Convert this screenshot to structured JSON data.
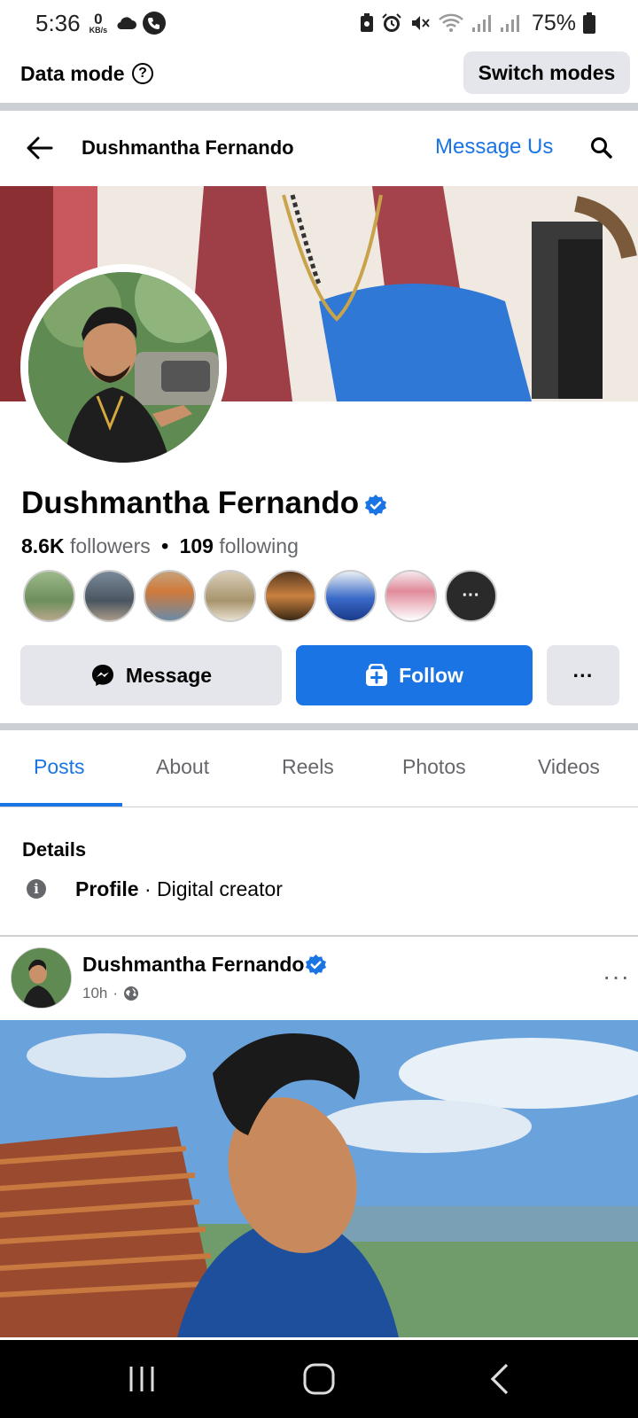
{
  "status_bar": {
    "time": "5:36",
    "net_speed_value": "0",
    "net_speed_unit": "KB/s",
    "battery_percent": "75%",
    "icons": [
      "cloud-icon",
      "phone-icon",
      "battery-saver-icon",
      "alarm-icon",
      "mute-icon",
      "wifi-icon",
      "signal-icon",
      "signal-icon",
      "battery-icon"
    ]
  },
  "data_mode": {
    "label": "Data mode",
    "help_icon": "?",
    "switch_label": "Switch modes"
  },
  "header": {
    "title": "Dushmantha Fernando",
    "message_us": "Message Us"
  },
  "profile": {
    "name": "Dushmantha Fernando",
    "followers_count": "8.6K",
    "followers_label": "followers",
    "following_count": "109",
    "following_label": "following",
    "verified": true,
    "friends_preview_count": 8
  },
  "actions": {
    "message": "Message",
    "follow": "Follow",
    "more": "···"
  },
  "tabs": [
    {
      "label": "Posts",
      "active": true
    },
    {
      "label": "About",
      "active": false
    },
    {
      "label": "Reels",
      "active": false
    },
    {
      "label": "Photos",
      "active": false
    },
    {
      "label": "Videos",
      "active": false
    }
  ],
  "details": {
    "title": "Details",
    "type_label": "Profile",
    "type_value": " · Digital creator"
  },
  "post": {
    "author": "Dushmantha Fernando",
    "time": "10h",
    "dot": "·",
    "privacy_icon": "globe-icon"
  },
  "colors": {
    "accent": "#1b74e4",
    "secondary_text": "#65676b",
    "button_gray": "#e4e6eb"
  }
}
